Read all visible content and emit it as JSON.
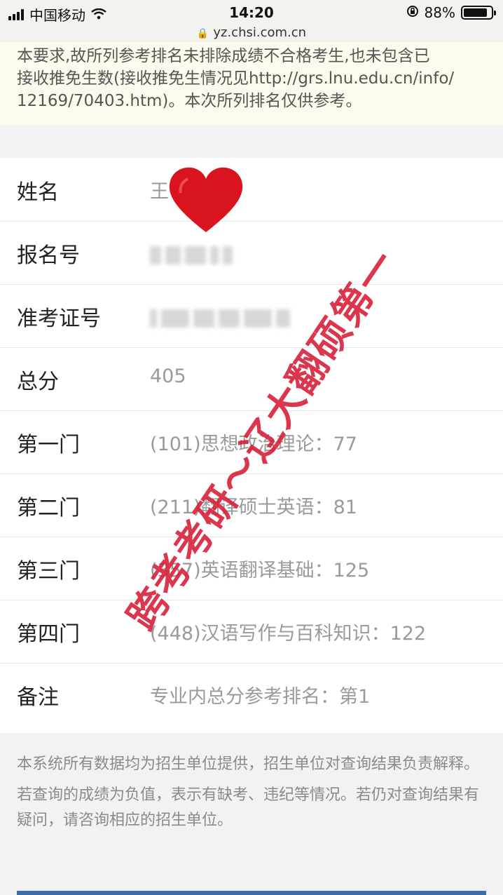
{
  "status_bar": {
    "carrier": "中国移动",
    "time": "14:20",
    "battery_text": "88%",
    "battery_level": 0.88,
    "url": "yz.chsi.com.cn"
  },
  "notice": {
    "lines": [
      "本要求,故所列参考排名未排除成绩不合格考生,也未包含已",
      "接收推免生数(接收推免生情况见http://grs.lnu.edu.cn/info/",
      "12169/70403.htm)。本次所列排名仅供参考。"
    ]
  },
  "rows": {
    "name": {
      "label": "姓名",
      "value": "王"
    },
    "reg_no": {
      "label": "报名号"
    },
    "exam_no": {
      "label": "准考证号"
    },
    "total": {
      "label": "总分",
      "value": "405"
    },
    "subject1": {
      "label": "第一门",
      "value": "(101)思想政治理论：77"
    },
    "subject2": {
      "label": "第二门",
      "value": "(211)翻译硕士英语：81"
    },
    "subject3": {
      "label": "第三门",
      "value": "(357)英语翻译基础：125"
    },
    "subject4": {
      "label": "第四门",
      "value": "(448)汉语写作与百科知识：122"
    },
    "remark": {
      "label": "备注",
      "value": "专业内总分参考排名：第1"
    }
  },
  "footer": {
    "p1": "本系统所有数据均为招生单位提供，招生单位对查询结果负责解释。",
    "p2": "若查询的成绩为负值，表示有缺考、违纪等情况。若仍对查询结果有疑问，请咨询相应的招生单位。"
  },
  "watermark": {
    "text": "跨考考研～辽大翻硕第一",
    "color": "#d8213a"
  }
}
